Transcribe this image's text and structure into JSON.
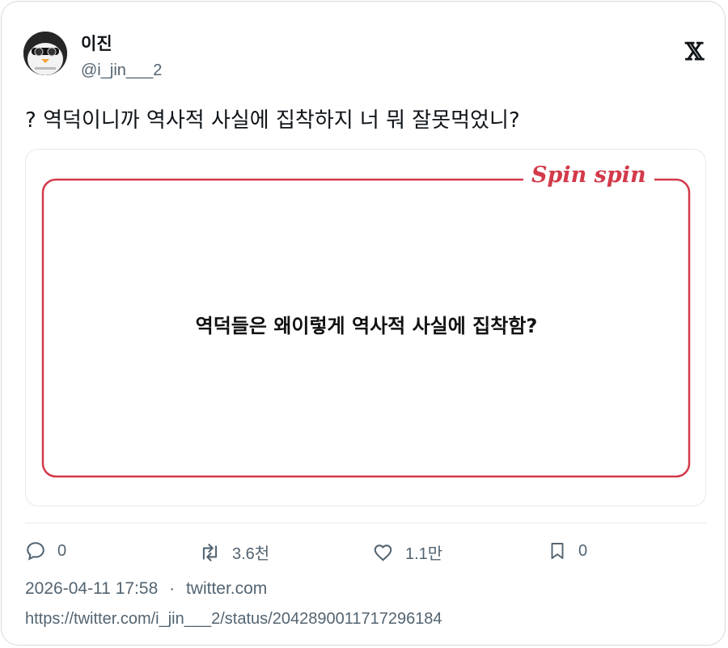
{
  "author": {
    "name": "이진",
    "handle": "@i_jin___2"
  },
  "tweet": {
    "text": "? 역덕이니까 역사적 사실에 집착하지 너 뭐 잘못먹었니?"
  },
  "media": {
    "brand": "Spin spin",
    "text": "역덕들은 왜이렇게 역사적 사실에 집착함?",
    "accent_color": "#d33a4a"
  },
  "actions": {
    "reply_count": "0",
    "retweet_count": "3.6천",
    "like_count": "1.1만",
    "bookmark_count": "0"
  },
  "meta": {
    "timestamp": "2026-04-11 17:58",
    "separator": "·",
    "source": "twitter.com",
    "url": "https://twitter.com/i_jin___2/status/2042890011717296184"
  },
  "icons": {
    "logo": "x-logo-icon",
    "reply": "reply-icon",
    "retweet": "retweet-icon",
    "like": "heart-icon",
    "bookmark": "bookmark-icon"
  }
}
